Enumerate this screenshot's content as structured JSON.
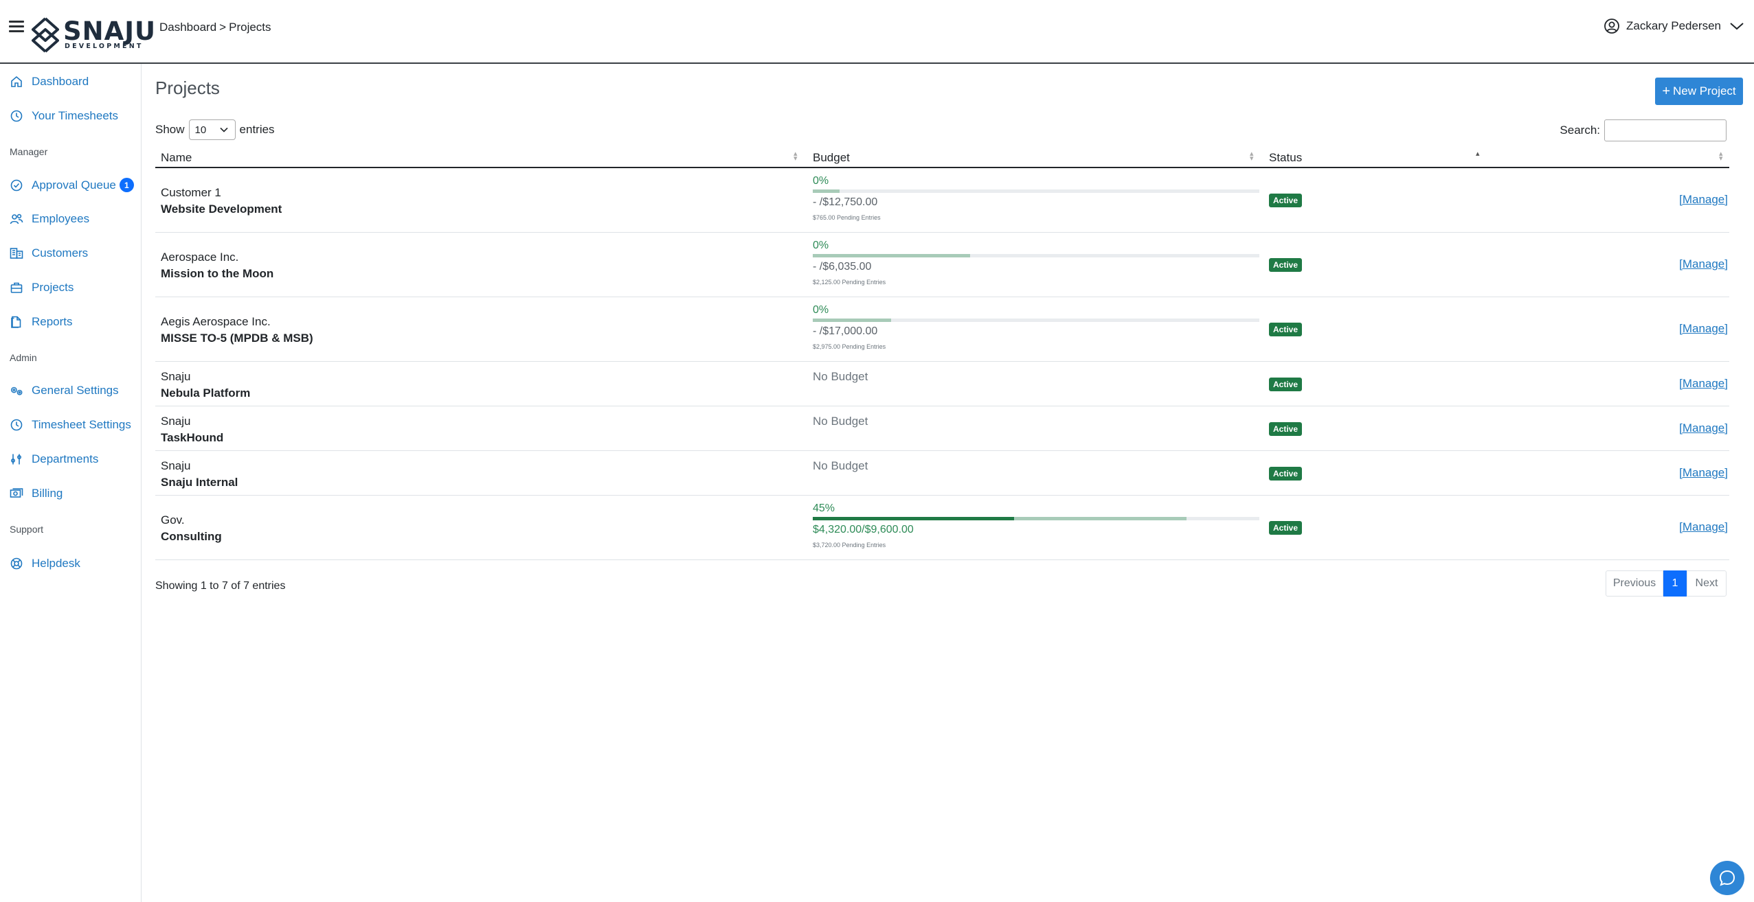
{
  "header": {
    "logo_text": "SNAJU",
    "logo_sub": "DEVELOPMENT",
    "breadcrumb": [
      "Dashboard",
      ">",
      "Projects"
    ],
    "user_name": "Zackary Pedersen"
  },
  "sidebar": {
    "items": [
      {
        "label": "Dashboard",
        "icon": "home-icon"
      },
      {
        "label": "Your Timesheets",
        "icon": "clock-icon"
      }
    ],
    "section_manager": "Manager",
    "manager_items": [
      {
        "label": "Approval Queue",
        "icon": "check-circle-icon",
        "badge": "1"
      },
      {
        "label": "Employees",
        "icon": "users-icon"
      },
      {
        "label": "Customers",
        "icon": "building-icon"
      },
      {
        "label": "Projects",
        "icon": "briefcase-icon"
      },
      {
        "label": "Reports",
        "icon": "file-icon"
      }
    ],
    "section_admin": "Admin",
    "admin_items": [
      {
        "label": "General Settings",
        "icon": "gears-icon"
      },
      {
        "label": "Timesheet Settings",
        "icon": "clock-icon"
      },
      {
        "label": "Departments",
        "icon": "sitemap-icon"
      },
      {
        "label": "Billing",
        "icon": "money-icon"
      }
    ],
    "section_support": "Support",
    "support_items": [
      {
        "label": "Helpdesk",
        "icon": "lifebuoy-icon"
      }
    ]
  },
  "main": {
    "title": "Projects",
    "new_button": "New Project",
    "show_label": "Show",
    "entries_value": "10",
    "entries_label": "entries",
    "search_label": "Search:",
    "search_value": "",
    "columns": [
      "Name",
      "Budget",
      "Status"
    ],
    "rows": [
      {
        "customer": "Customer 1",
        "project": "Website Development",
        "has_budget": true,
        "pct": "0%",
        "amount": "- /$12,750.00",
        "pending": "$765.00 Pending Entries",
        "spent_fraction": 0,
        "pending_fraction": 0.06,
        "status": "Active",
        "action": "[Manage]"
      },
      {
        "customer": "Aerospace Inc.",
        "project": "Mission to the Moon",
        "has_budget": true,
        "pct": "0%",
        "amount": "- /$6,035.00",
        "pending": "$2,125.00 Pending Entries",
        "spent_fraction": 0,
        "pending_fraction": 0.352,
        "status": "Active",
        "action": "[Manage]"
      },
      {
        "customer": "Aegis Aerospace Inc.",
        "project": "MISSE TO-5 (MPDB & MSB)",
        "has_budget": true,
        "pct": "0%",
        "amount": "- /$17,000.00",
        "pending": "$2,975.00 Pending Entries",
        "spent_fraction": 0,
        "pending_fraction": 0.175,
        "status": "Active",
        "action": "[Manage]"
      },
      {
        "customer": "Snaju",
        "project": "Nebula Platform",
        "has_budget": false,
        "no_budget": "No Budget",
        "status": "Active",
        "action": "[Manage]"
      },
      {
        "customer": "Snaju",
        "project": "TaskHound",
        "has_budget": false,
        "no_budget": "No Budget",
        "status": "Active",
        "action": "[Manage]"
      },
      {
        "customer": "Snaju",
        "project": "Snaju Internal",
        "has_budget": false,
        "no_budget": "No Budget",
        "status": "Active",
        "action": "[Manage]"
      },
      {
        "customer": "Gov.",
        "project": "Consulting",
        "has_budget": true,
        "pct": "45%",
        "amount": "$4,320.00/$9,600.00",
        "pending": "$3,720.00 Pending Entries",
        "spent_fraction": 0.45,
        "pending_fraction": 0.837,
        "status": "Active",
        "action": "[Manage]"
      }
    ],
    "info": "Showing 1 to 7 of 7 entries",
    "pager": {
      "prev": "Previous",
      "current": "1",
      "next": "Next"
    }
  },
  "colors": {
    "accent": "#2e86d6",
    "link": "#1f78c1",
    "active_badge": "#1f7a45",
    "progress_pending": "#a8cbb8"
  }
}
